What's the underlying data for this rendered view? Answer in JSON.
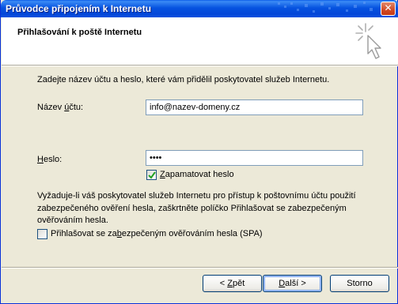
{
  "window": {
    "title": "Průvodce připojením k Internetu"
  },
  "header": {
    "title": "Přihlašování k poště Internetu"
  },
  "intro_text": "Zadejte název účtu a heslo, které vám přidělil poskytovatel služeb Internetu.",
  "account": {
    "label": "Název účtu:",
    "value": "info@nazev-domeny.cz"
  },
  "password": {
    "label": "Heslo:",
    "value": "••••"
  },
  "remember_password": {
    "label": "Zapamatovat heslo",
    "checked": true
  },
  "spa_info": {
    "line1": "Vyžaduje-li váš poskytovatel služeb Internetu pro přístup k poštovnímu účtu použití",
    "line2": "zabezpečeného ověření hesla, zaškrtněte políčko Přihlašovat se zabezpečeným",
    "line3": "ověřováním hesla."
  },
  "spa_checkbox": {
    "label": "Přihlašovat se zabezpečeným ověřováním hesla (SPA)",
    "checked": false
  },
  "buttons": {
    "back": "< Zpět",
    "next": "Další >",
    "cancel": "Storno"
  },
  "icons": {
    "close": "close-icon",
    "wizard": "wizard-cursor-icon",
    "check": "check-icon"
  }
}
